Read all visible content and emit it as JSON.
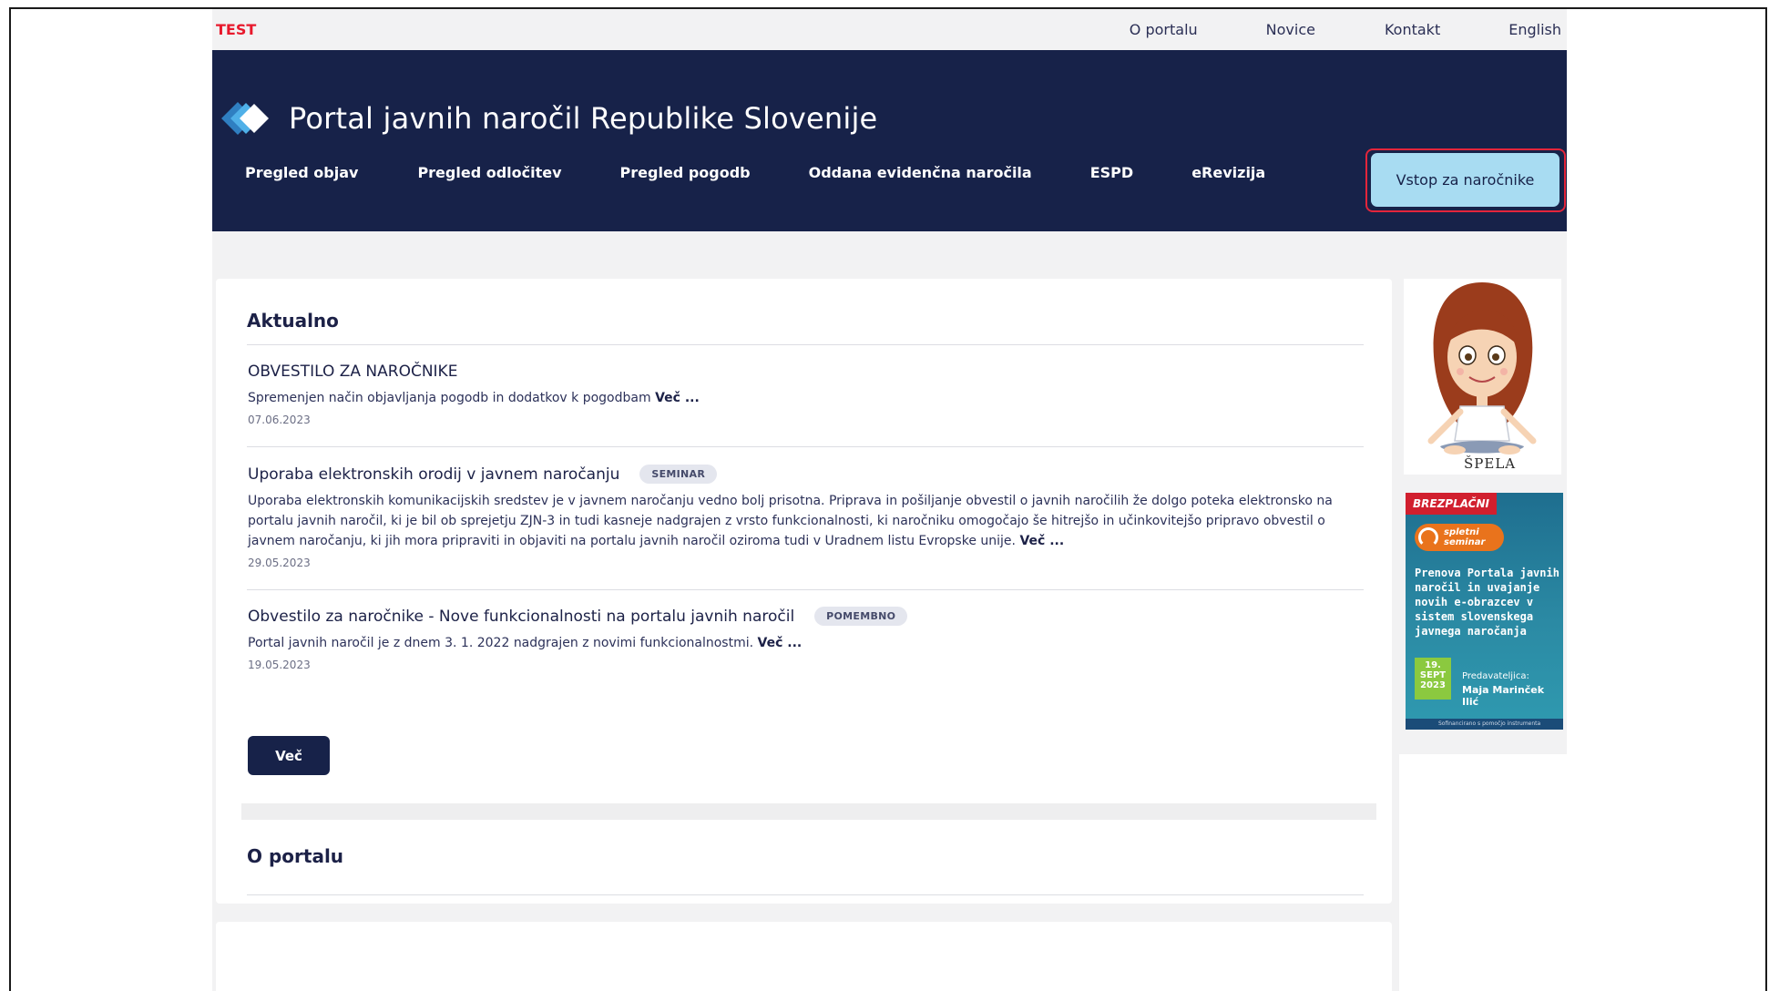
{
  "topbar": {
    "test_label": "TEST",
    "links": [
      "O portalu",
      "Novice",
      "Kontakt",
      "English"
    ]
  },
  "header": {
    "title": "Portal javnih naročil Republike Slovenije",
    "nav": [
      "Pregled objav",
      "Pregled odločitev",
      "Pregled pogodb",
      "Oddana evidenčna naročila",
      "ESPD",
      "eRevizija"
    ],
    "login_label": "Vstop za naročnike"
  },
  "main": {
    "section_title": "Aktualno",
    "news": [
      {
        "title": "OBVESTILO ZA NAROČNIKE",
        "badge": "",
        "text": "Spremenjen način objavljanja pogodb in dodatkov k pogodbam",
        "more": "Več ...",
        "date": "07.06.2023"
      },
      {
        "title": "Uporaba elektronskih orodij v javnem naročanju",
        "badge": "SEMINAR",
        "text": "Uporaba elektronskih komunikacijskih sredstev je v javnem naročanju vedno bolj prisotna. Priprava in pošiljanje obvestil o javnih naročilih že dolgo poteka elektronsko na portalu javnih naročil, ki je bil ob sprejetju ZJN-3 in tudi kasneje nadgrajen z vrsto funkcionalnosti, ki naročniku omogočajo še hitrejšo in učinkovitejšo pripravo obvestil o javnem naročanju, ki jih mora pripraviti in objaviti na portalu javnih naročil oziroma tudi v Uradnem listu Evropske unije.",
        "more": "Več ...",
        "date": "29.05.2023"
      },
      {
        "title": "Obvestilo za naročnike - Nove funkcionalnosti na portalu javnih naročil",
        "badge": "POMEMBNO",
        "text": "Portal javnih naročil je z dnem 3. 1. 2022 nadgrajen z novimi funkcionalnostmi.",
        "more": "Več ...",
        "date": "19.05.2023"
      }
    ],
    "more_button": "Več",
    "about_title": "O portalu"
  },
  "sidebar": {
    "mascot_caption": "ŠPELA",
    "promo": {
      "tag": "BREZPLAČNI",
      "pill": "spletni seminar",
      "text": "Prenova Portala javnih naročil in uvajanje novih e-obrazcev v sistem slovenskega javnega naročanja",
      "date_day": "19.",
      "date_month": "SEPT",
      "date_year": "2023",
      "lecturer_label": "Predavateljica:",
      "lecturer_name": "Maja Marinček Ilić",
      "footer": "Sofinancirano s pomočjo instrumenta"
    }
  },
  "colors": {
    "header_bg": "#172249",
    "login_bg": "#a8dcf2",
    "test_red": "#e8192c",
    "highlight_outline": "#e3253b"
  }
}
